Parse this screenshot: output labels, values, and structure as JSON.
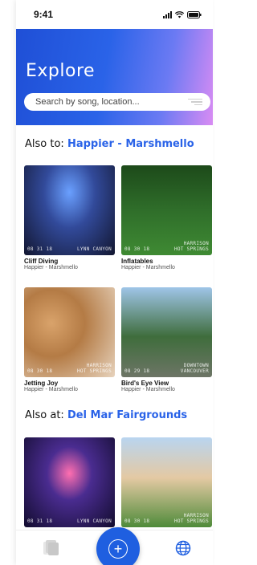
{
  "status": {
    "time": "9:41"
  },
  "hero": {
    "title": "Explore",
    "search_placeholder": "Search by song, location..."
  },
  "section1": {
    "prefix": "Also to:",
    "accent": "Happier - Marshmello",
    "cards": [
      {
        "title": "Cliff Diving",
        "subtitle": "Happier - Marshmello",
        "date": "08 31 18",
        "location": "LYNN CANYON"
      },
      {
        "title": "Inflatables",
        "subtitle": "Happier - Marshmello",
        "date": "08 30 18",
        "location": "HARRISON\nHOT SPRINGS"
      },
      {
        "title": "Jetting Joy",
        "subtitle": "Happier - Marshmello",
        "date": "08 30 18",
        "location": "HARRISON\nHOT SPRINGS"
      },
      {
        "title": "Bird's Eye View",
        "subtitle": "Happier - Marshmello",
        "date": "08 29 18",
        "location": "DOWNTOWN\nVANCOUVER"
      }
    ]
  },
  "section2": {
    "prefix": "Also at:",
    "accent": "Del Mar Fairgrounds",
    "cards": [
      {
        "date": "08 31 18",
        "location": "LYNN CANYON"
      },
      {
        "date": "08 30 18",
        "location": "HARRISON\nHOT SPRINGS"
      }
    ]
  },
  "tabbar": {
    "fab_symbol": "+"
  },
  "icons": {
    "left_tab": "stacked-cards-icon",
    "center": "plus-circle-icon",
    "right_tab": "globe-icon"
  },
  "colors": {
    "accent": "#2a63e8",
    "fab": "#1f5fe0"
  }
}
